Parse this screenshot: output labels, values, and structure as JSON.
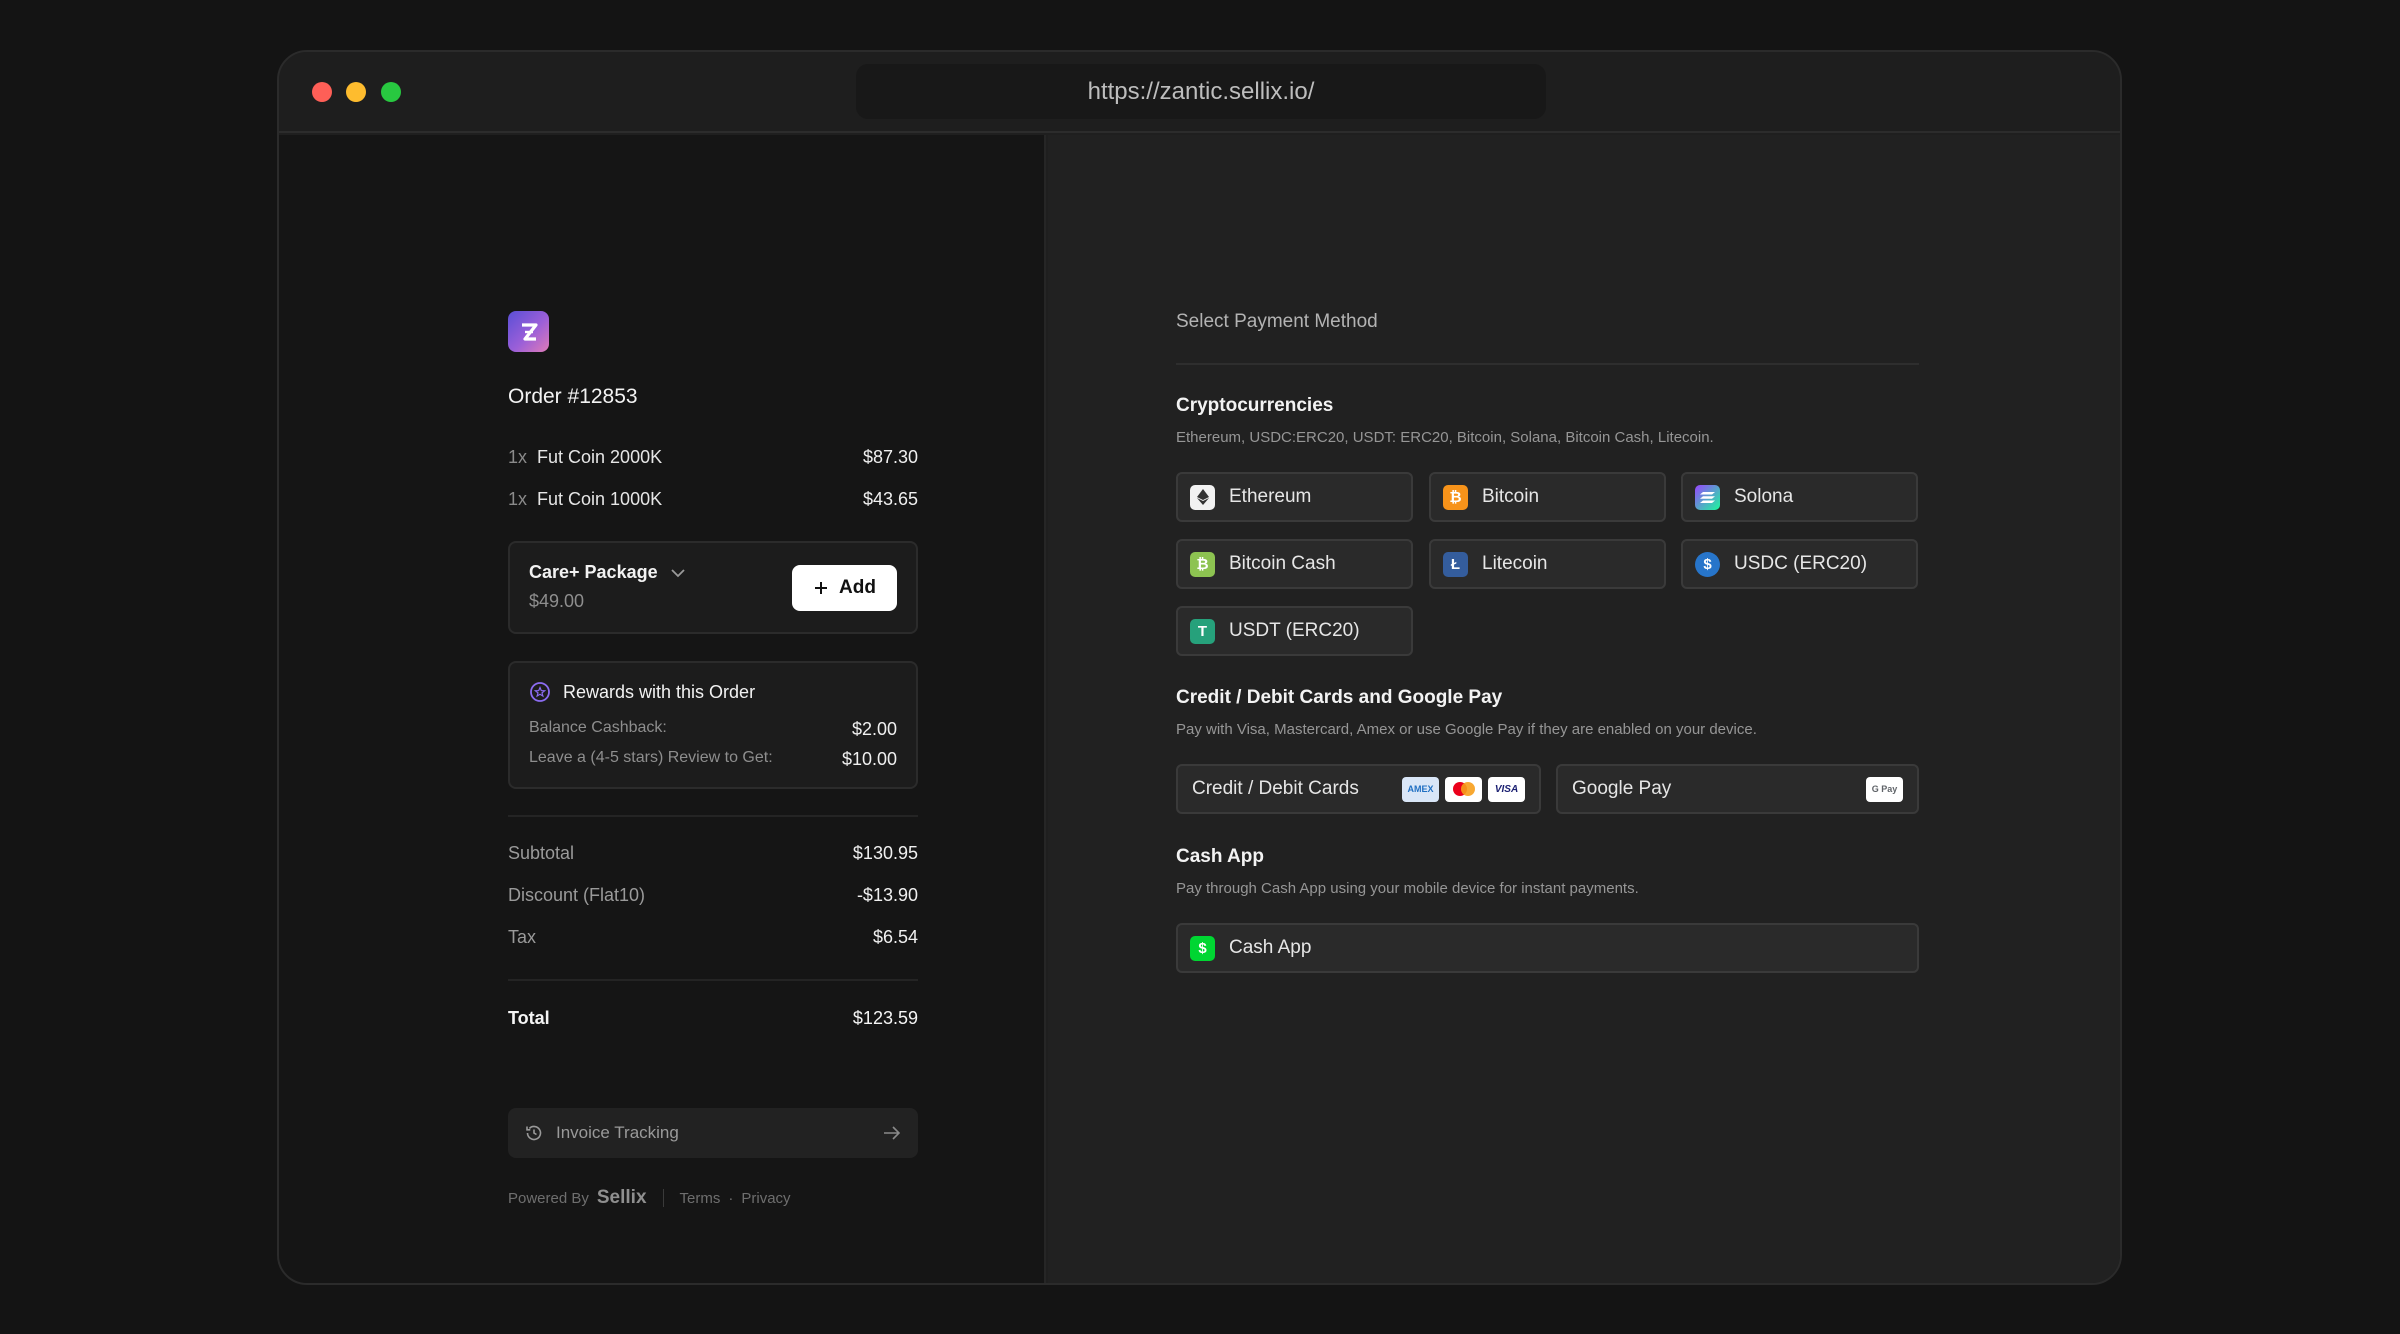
{
  "browser": {
    "url": "https://zantic.sellix.io/"
  },
  "order": {
    "title": "Order #12853",
    "items": [
      {
        "qty": "1x",
        "name": "Fut Coin 2000K",
        "price": "$87.30"
      },
      {
        "qty": "1x",
        "name": "Fut Coin 1000K",
        "price": "$43.65"
      }
    ],
    "care": {
      "title": "Care+ Package",
      "price": "$49.00",
      "add_label": "Add"
    },
    "rewards": {
      "title": "Rewards with this Order",
      "rows": [
        {
          "label": "Balance Cashback:",
          "value": "$2.00"
        },
        {
          "label": "Leave a (4-5 stars) Review to Get:",
          "value": "$10.00"
        }
      ]
    },
    "summary": [
      {
        "label": "Subtotal",
        "value": "$130.95"
      },
      {
        "label": "Discount (Flat10)",
        "value": "-$13.90"
      },
      {
        "label": "Tax",
        "value": "$6.54"
      }
    ],
    "total": {
      "label": "Total",
      "value": "$123.59"
    },
    "invoice_label": "Invoice Tracking",
    "footer": {
      "powered_by": "Powered By",
      "brand": "Sellix",
      "terms": "Terms",
      "dot": "·",
      "privacy": "Privacy"
    }
  },
  "payment": {
    "title": "Select Payment Method",
    "crypto": {
      "title": "Cryptocurrencies",
      "description": "Ethereum, USDC:ERC20, USDT: ERC20, Bitcoin, Solana, Bitcoin Cash, Litecoin.",
      "methods": [
        {
          "label": "Ethereum",
          "icon": "ethereum-icon",
          "color": "#f2f2f2"
        },
        {
          "label": "Bitcoin",
          "icon": "bitcoin-icon",
          "color": "#f7931a"
        },
        {
          "label": "Solona",
          "icon": "solana-icon",
          "color": "#9b6bf0"
        },
        {
          "label": "Bitcoin Cash",
          "icon": "bitcoin-cash-icon",
          "color": "#8dc351"
        },
        {
          "label": "Litecoin",
          "icon": "litecoin-icon",
          "color": "#345d9d"
        },
        {
          "label": "USDC (ERC20)",
          "icon": "usdc-icon",
          "color": "#2775ca"
        },
        {
          "label": "USDT (ERC20)",
          "icon": "usdt-icon",
          "color": "#26a17b"
        }
      ]
    },
    "cards": {
      "title": "Credit / Debit Cards and Google Pay",
      "description": "Pay with Visa, Mastercard, Amex or use Google Pay if they are enabled on your device.",
      "card_label": "Credit / Debit Cards",
      "gpay_label": "Google Pay",
      "logo_amex": "AMEX",
      "logo_visa": "VISA",
      "logo_gpay": "G Pay"
    },
    "cashapp": {
      "title": "Cash App",
      "description": "Pay through Cash App using your mobile device for instant payments.",
      "label": "Cash App",
      "color": "#00d632"
    }
  }
}
